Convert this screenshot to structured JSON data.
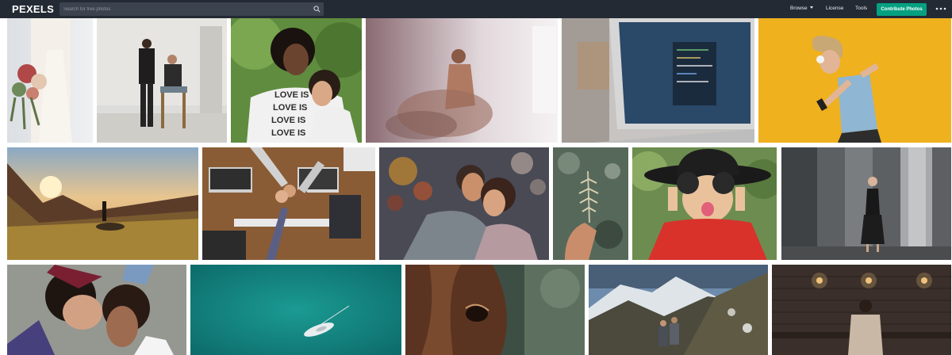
{
  "header": {
    "logo": "PEXELS",
    "search_placeholder": "Search for free photos",
    "nav": {
      "browse": "Browse",
      "license": "License",
      "tools": "Tools",
      "contribute": "Contribute Photos"
    }
  },
  "colors": {
    "topbar": "#232a34",
    "search_bg": "#3b434e",
    "accent_green": "#05a081"
  },
  "photos": [
    {
      "subject": "bride holding bouquet"
    },
    {
      "subject": "two men posing in white studio"
    },
    {
      "subject": "mother and daughter hugging, LOVE IS shirt",
      "shirt_text": "LOVE IS"
    },
    {
      "subject": "man dissolving into dust"
    },
    {
      "subject": "laptop with code on screen"
    },
    {
      "subject": "woman with headphones on yellow background"
    },
    {
      "subject": "person on mountain at sunset"
    },
    {
      "subject": "team fist bump over desk with laptops"
    },
    {
      "subject": "couple smiling with bokeh lights"
    },
    {
      "subject": "hand holding fern leaf"
    },
    {
      "subject": "girl in witch hat and red cape"
    },
    {
      "subject": "woman in black dress near columns"
    },
    {
      "subject": "two girls lying on the ground"
    },
    {
      "subject": "boat on turquoise water from above"
    },
    {
      "subject": "horse eye close-up"
    },
    {
      "subject": "hikers in snowy mountains"
    },
    {
      "subject": "man at brick wall with lamps"
    }
  ]
}
